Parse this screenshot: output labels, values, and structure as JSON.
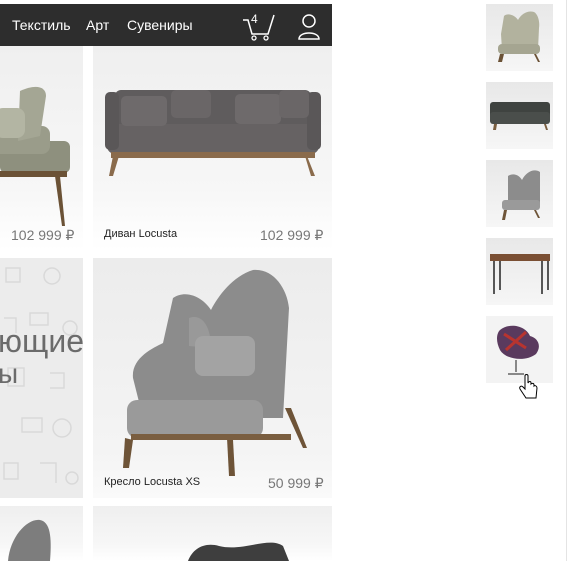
{
  "nav": {
    "items": [
      "Текстиль",
      "Арт",
      "Сувениры"
    ],
    "cart_count": "4"
  },
  "products": [
    {
      "name": "",
      "price": "102 999 ₽"
    },
    {
      "name": "Диван Locusta",
      "price": "102 999 ₽"
    },
    {
      "name": "Кресло Locusta XS",
      "price": "50 999 ₽"
    }
  ],
  "promo": {
    "line1": "ющие",
    "line2": "ы"
  },
  "thumbnails": [
    "armchair-thumb",
    "sofa-thumb",
    "chair-thumb",
    "console-table-thumb",
    "swan-chair-thumb"
  ],
  "colors": {
    "header_bg": "#2d2d2d",
    "price_text": "#777777",
    "card_bg": "#efefef"
  }
}
